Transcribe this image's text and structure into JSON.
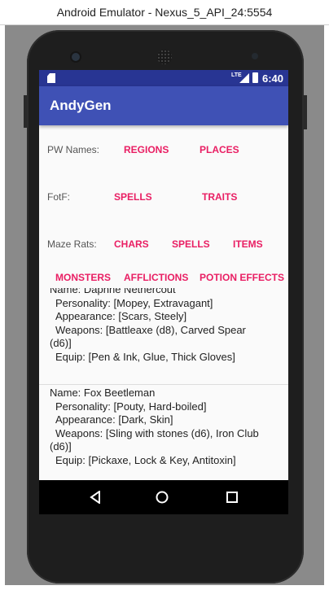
{
  "window": {
    "title": "Android Emulator - Nexus_5_API_24:5554"
  },
  "statusbar": {
    "network_label": "LTE",
    "time": "6:40",
    "icons": [
      "sd-card-icon",
      "signal-icon",
      "battery-icon"
    ]
  },
  "app": {
    "title": "AndyGen",
    "primary_color": "#3f51b5",
    "status_color": "#283593",
    "accent_color": "#e91e63"
  },
  "rows": {
    "pw": {
      "label": "PW Names:",
      "buttons": [
        "REGIONS",
        "PLACES"
      ]
    },
    "fotf": {
      "label": "FotF:",
      "buttons": [
        "SPELLS",
        "TRAITS"
      ]
    },
    "maze": {
      "label": "Maze Rats:",
      "buttons": [
        "CHARS",
        "SPELLS",
        "ITEMS"
      ]
    },
    "maze2": {
      "buttons": [
        "MONSTERS",
        "AFFLICTIONS",
        "POTION EFFECTS"
      ]
    }
  },
  "results": [
    {
      "name": "Name: Daphne Nethercout",
      "personality": "Personality: [Mopey, Extravagant]",
      "appearance": "Appearance:  [Scars, Steely]",
      "weapons": "Weapons:     [Battleaxe (d8), Carved Spear",
      "weapons_cont": "(d6)]",
      "equip": "Equip:       [Pen & Ink, Glue, Thick Gloves]"
    },
    {
      "name": "Name: Fox Beetleman",
      "personality": "Personality: [Pouty, Hard-boiled]",
      "appearance": "Appearance:  [Dark, Skin]",
      "weapons": "Weapons:     [Sling with stones (d6), Iron Club",
      "weapons_cont": "(d6)]",
      "equip": "Equip:       [Pickaxe, Lock & Key, Antitoxin]"
    }
  ],
  "navbar": {
    "icons": [
      "back-icon",
      "home-icon",
      "recents-icon"
    ]
  }
}
